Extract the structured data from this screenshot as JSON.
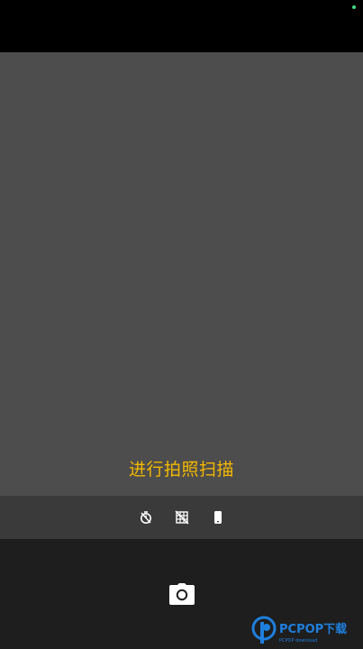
{
  "scan_hint": "进行拍照扫描",
  "colors": {
    "hint": "#f5b800",
    "viewfinder": "#4d4d4d",
    "toolbar": "#3a3a3a",
    "bottom_panel": "#1e1e1e",
    "status_dot": "#3ddc84",
    "watermark_blue": "#1e90ff"
  },
  "toolbar": {
    "icons": [
      "timer-icon",
      "grid-off-icon",
      "phone-orientation-icon"
    ]
  },
  "shutter": {
    "icon": "camera-icon"
  },
  "watermark": {
    "brand": "PCPOP下载",
    "tagline": "PCPOP download"
  }
}
